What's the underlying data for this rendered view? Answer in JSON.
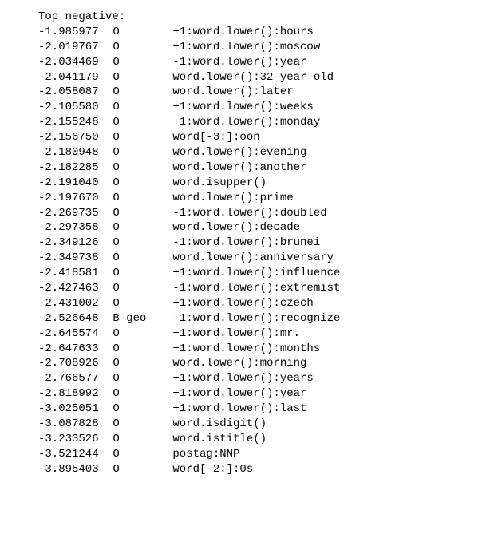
{
  "header": "Top negative:",
  "rows": [
    {
      "weight": "-1.985977",
      "label": "O",
      "feature": "+1:word.lower():hours"
    },
    {
      "weight": "-2.019767",
      "label": "O",
      "feature": "+1:word.lower():moscow"
    },
    {
      "weight": "-2.034469",
      "label": "O",
      "feature": "-1:word.lower():year"
    },
    {
      "weight": "-2.041179",
      "label": "O",
      "feature": "word.lower():32-year-old"
    },
    {
      "weight": "-2.058087",
      "label": "O",
      "feature": "word.lower():later"
    },
    {
      "weight": "-2.105580",
      "label": "O",
      "feature": "+1:word.lower():weeks"
    },
    {
      "weight": "-2.155248",
      "label": "O",
      "feature": "+1:word.lower():monday"
    },
    {
      "weight": "-2.156750",
      "label": "O",
      "feature": "word[-3:]:oon"
    },
    {
      "weight": "-2.180948",
      "label": "O",
      "feature": "word.lower():evening"
    },
    {
      "weight": "-2.182285",
      "label": "O",
      "feature": "word.lower():another"
    },
    {
      "weight": "-2.191040",
      "label": "O",
      "feature": "word.isupper()"
    },
    {
      "weight": "-2.197670",
      "label": "O",
      "feature": "word.lower():prime"
    },
    {
      "weight": "-2.269735",
      "label": "O",
      "feature": "-1:word.lower():doubled"
    },
    {
      "weight": "-2.297358",
      "label": "O",
      "feature": "word.lower():decade"
    },
    {
      "weight": "-2.349126",
      "label": "O",
      "feature": "-1:word.lower():brunei"
    },
    {
      "weight": "-2.349738",
      "label": "O",
      "feature": "word.lower():anniversary"
    },
    {
      "weight": "-2.418581",
      "label": "O",
      "feature": "+1:word.lower():influence"
    },
    {
      "weight": "-2.427463",
      "label": "O",
      "feature": "-1:word.lower():extremist"
    },
    {
      "weight": "-2.431002",
      "label": "O",
      "feature": "+1:word.lower():czech"
    },
    {
      "weight": "-2.526648",
      "label": "B-geo",
      "feature": "-1:word.lower():recognize"
    },
    {
      "weight": "-2.645574",
      "label": "O",
      "feature": "+1:word.lower():mr."
    },
    {
      "weight": "-2.647633",
      "label": "O",
      "feature": "+1:word.lower():months"
    },
    {
      "weight": "-2.708926",
      "label": "O",
      "feature": "word.lower():morning"
    },
    {
      "weight": "-2.766577",
      "label": "O",
      "feature": "+1:word.lower():years"
    },
    {
      "weight": "-2.818992",
      "label": "O",
      "feature": "+1:word.lower():year"
    },
    {
      "weight": "-3.025051",
      "label": "O",
      "feature": "+1:word.lower():last"
    },
    {
      "weight": "-3.087828",
      "label": "O",
      "feature": "word.isdigit()"
    },
    {
      "weight": "-3.233526",
      "label": "O",
      "feature": "word.istitle()"
    },
    {
      "weight": "-3.521244",
      "label": "O",
      "feature": "postag:NNP"
    },
    {
      "weight": "-3.895403",
      "label": "O",
      "feature": "word[-2:]:0s"
    }
  ]
}
